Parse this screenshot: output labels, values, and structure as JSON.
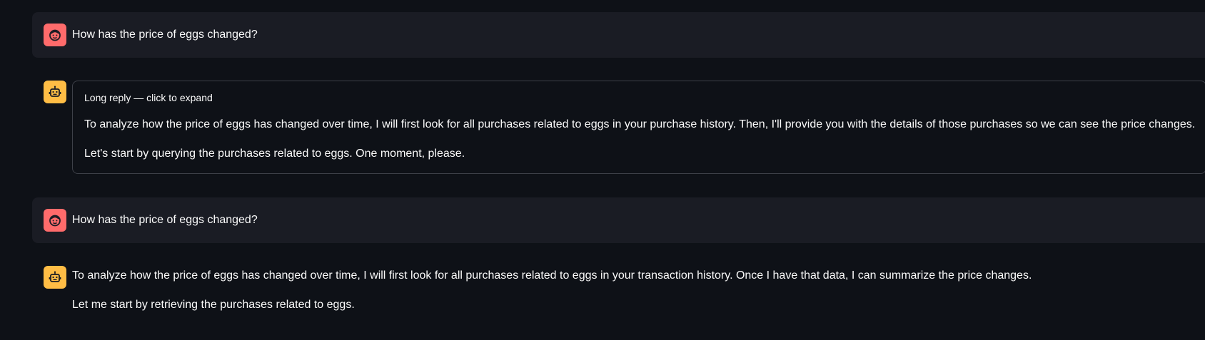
{
  "messages": [
    {
      "role": "user",
      "avatar_icon": "user-face-icon",
      "text": "How has the price of eggs changed?"
    },
    {
      "role": "assistant",
      "avatar_icon": "robot-icon",
      "expander_label": "Long reply — click to expand",
      "paragraphs": [
        "To analyze how the price of eggs has changed over time, I will first look for all purchases related to eggs in your purchase history. Then, I'll provide you with the details of those purchases so we can see the price changes.",
        "Let's start by querying the purchases related to eggs. One moment, please."
      ]
    },
    {
      "role": "user",
      "avatar_icon": "user-face-icon",
      "text": "How has the price of eggs changed?"
    },
    {
      "role": "assistant",
      "avatar_icon": "robot-icon",
      "paragraphs": [
        "To analyze how the price of eggs has changed over time, I will first look for all purchases related to eggs in your transaction history. Once I have that data, I can summarize the price changes.",
        "Let me start by retrieving the purchases related to eggs."
      ]
    }
  ],
  "colors": {
    "background": "#0e1117",
    "user_bubble": "#1a1c24",
    "user_avatar": "#ff6b6b",
    "bot_avatar": "#ffbd45",
    "text": "#fafafa",
    "border": "#3d4048"
  }
}
